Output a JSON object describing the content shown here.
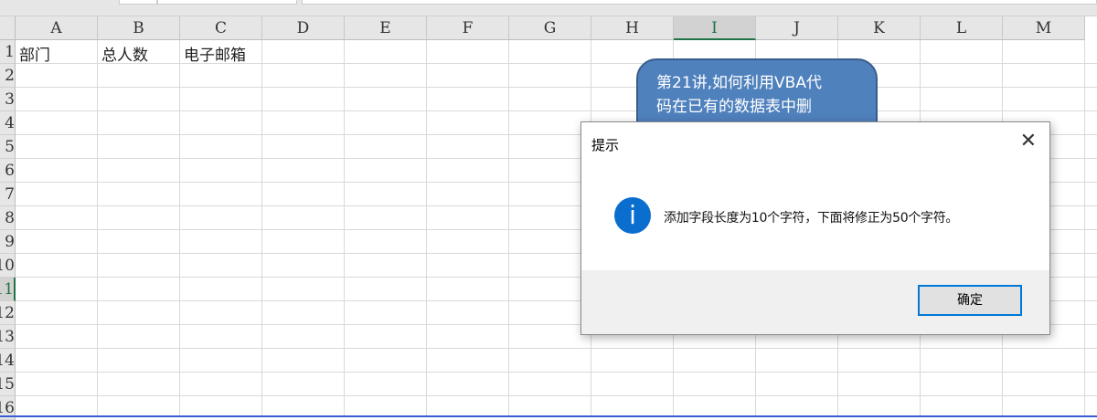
{
  "columns": [
    "A",
    "B",
    "C",
    "D",
    "E",
    "F",
    "G",
    "H",
    "I",
    "J",
    "K",
    "L",
    "M"
  ],
  "selected_column": "I",
  "rows": [
    "1",
    "2",
    "3",
    "4",
    "5",
    "6",
    "7",
    "8",
    "9",
    "10",
    "11",
    "12",
    "13",
    "14",
    "15",
    "16"
  ],
  "selected_row": "11",
  "cells": {
    "A1": "部门",
    "B1": "总人数",
    "C1": "电子邮箱"
  },
  "callout": {
    "line1": "第21讲,如何利用VBA代",
    "line2": "码在已有的数据表中删"
  },
  "dialog": {
    "title": "提示",
    "close": "✕",
    "icon": "i",
    "message": "添加字段长度为10个字符，下面将修正为50个字符。",
    "ok_label": "确定"
  },
  "colors": {
    "accent": "#217346",
    "callout": "#4f81bd",
    "info": "#0a6ecf"
  }
}
